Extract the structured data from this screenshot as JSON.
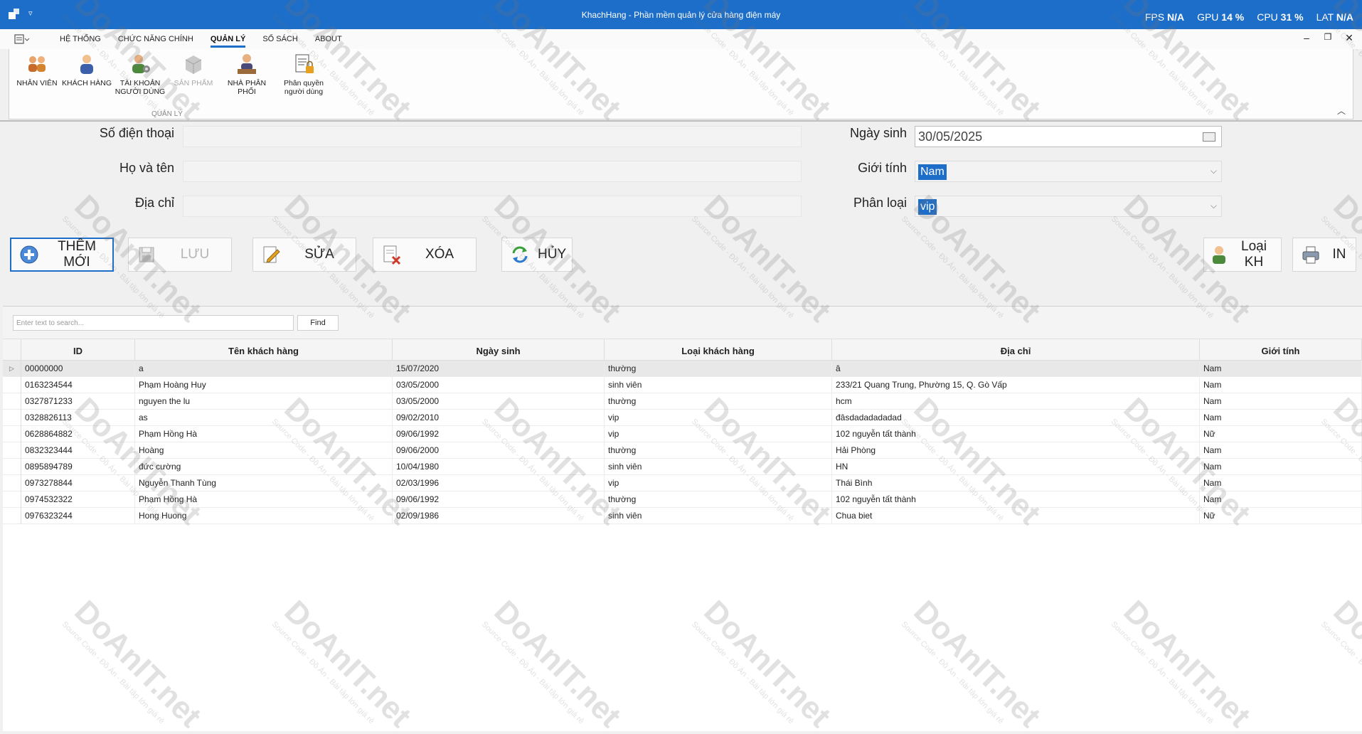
{
  "titlebar": {
    "qat_glyph": "▿",
    "title": "KhachHang - Phần mềm quản lý cửa hàng điện máy",
    "fps_label": "FPS",
    "fps_value": "N/A",
    "gpu_label": "GPU",
    "gpu_value": "14 %",
    "cpu_label": "CPU",
    "cpu_value": "31 %",
    "lat_label": "LAT",
    "lat_value": "N/A"
  },
  "menu": {
    "tabs": [
      "HỆ THỐNG",
      "CHỨC NĂNG CHÍNH",
      "QUẢN LÝ",
      "SỔ SÁCH",
      "ABOUT"
    ],
    "active_tab": "QUẢN LÝ",
    "minimize": "–",
    "restore": "❐",
    "close": "✕"
  },
  "ribbon": {
    "group_label": "QUẢN LÝ",
    "collapse": "︿",
    "items": [
      {
        "label": "NHÂN VIÊN",
        "icon": "staff-icon"
      },
      {
        "label": "KHÁCH HÀNG",
        "icon": "customer-icon"
      },
      {
        "label": "TÀI KHOẢN NGƯỜI DÙNG",
        "icon": "user-account-icon"
      },
      {
        "label": "SẢN PHẨM",
        "icon": "product-icon"
      },
      {
        "label": "NHÀ PHÂN PHỐI",
        "icon": "distributor-icon"
      },
      {
        "label": "Phân quyền người dùng",
        "icon": "permission-icon"
      }
    ]
  },
  "form": {
    "phone_label": "Số điện thoại",
    "name_label": "Họ và tên",
    "address_label": "Địa chỉ",
    "birth_label": "Ngày sinh",
    "birth_value": "30/05/2025",
    "gender_label": "Giới tính",
    "gender_value": "Nam",
    "type_label": "Phân loại",
    "type_value": "vip"
  },
  "buttons": {
    "add": "THÊM MỚI",
    "save": "LƯU",
    "edit": "SỬA",
    "delete": "XÓA",
    "cancel": "HỦY",
    "customer_type": "Loại KH",
    "print": "IN"
  },
  "search": {
    "placeholder": "Enter text to search...",
    "find": "Find"
  },
  "grid": {
    "row_indicator": "▷",
    "columns": [
      "ID",
      "Tên khách hàng",
      "Ngày sinh",
      "Loại khách hàng",
      "Địa chỉ",
      "Giới tính"
    ],
    "rows": [
      [
        "00000000",
        "a",
        "15/07/2020",
        "thường",
        "â",
        "Nam"
      ],
      [
        "0163234544",
        "Phạm Hoàng Huy",
        "03/05/2000",
        "sinh viên",
        "233/21 Quang Trung, Phường 15, Q. Gò Vấp",
        "Nam"
      ],
      [
        "0327871233",
        "nguyen the lu",
        "03/05/2000",
        "thường",
        "hcm",
        "Nam"
      ],
      [
        "0328826113",
        "as",
        "09/02/2010",
        "vip",
        "đâsdadadadadad",
        "Nam"
      ],
      [
        "0628864882",
        "Phạm Hồng Hà",
        "09/06/1992",
        "vip",
        "102 nguyễn tất thành",
        "Nữ"
      ],
      [
        "0832323444",
        "Hoàng",
        "09/06/2000",
        "thường",
        " Hải Phòng",
        "Nam"
      ],
      [
        "0895894789",
        "đức cường",
        "10/04/1980",
        "sinh viên",
        "HN",
        "Nam"
      ],
      [
        "0973278844",
        "Nguyễn Thanh Tùng",
        "02/03/1996",
        "vip",
        "Thái Bình",
        "Nam"
      ],
      [
        "0974532322",
        "Phạm Hồng Hà",
        "09/06/1992",
        "thường",
        "102 nguyễn tất thành",
        "Nam"
      ],
      [
        "0976323244",
        "Hong Huong",
        "02/09/1986",
        "sinh viên",
        "Chua biet",
        "Nữ"
      ]
    ]
  },
  "watermark": {
    "brand": "DoAnIT.net",
    "tagline": "Source Code - Đồ Án - Bài tập lớn giá rẻ"
  },
  "colors": {
    "accent": "#1d6ec8",
    "background": "#f0f0f0"
  }
}
